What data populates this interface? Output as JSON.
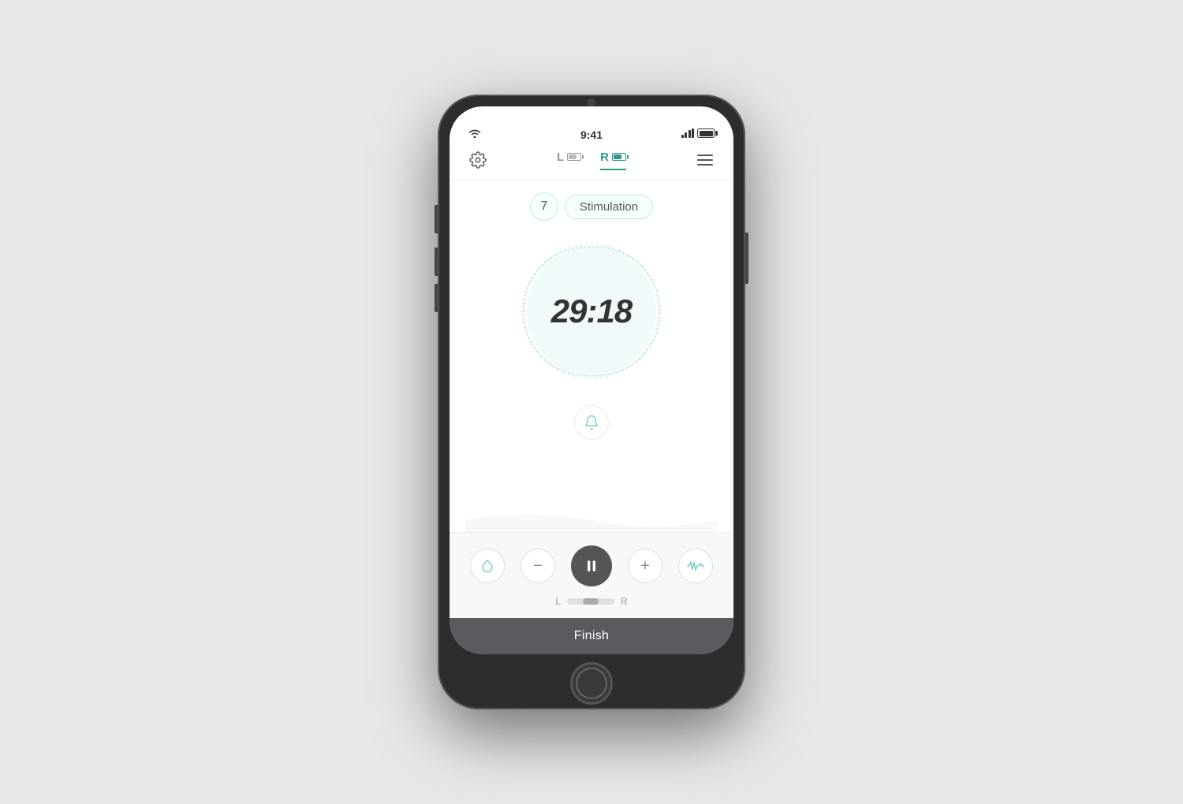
{
  "status_bar": {
    "time": "9:41",
    "wifi": "wifi",
    "signal": "signal",
    "battery": "battery"
  },
  "nav": {
    "left_tab_letter": "L",
    "right_tab_letter": "R",
    "settings_label": "settings",
    "menu_label": "menu"
  },
  "program": {
    "number": "7",
    "stimulation_label": "Stimulation"
  },
  "timer": {
    "display": "29:18"
  },
  "controls": {
    "drop_label": "drop",
    "minus_label": "−",
    "pause_label": "pause",
    "plus_label": "+",
    "wave_label": "wave",
    "left_label": "L",
    "right_label": "R",
    "finish_label": "Finish"
  }
}
